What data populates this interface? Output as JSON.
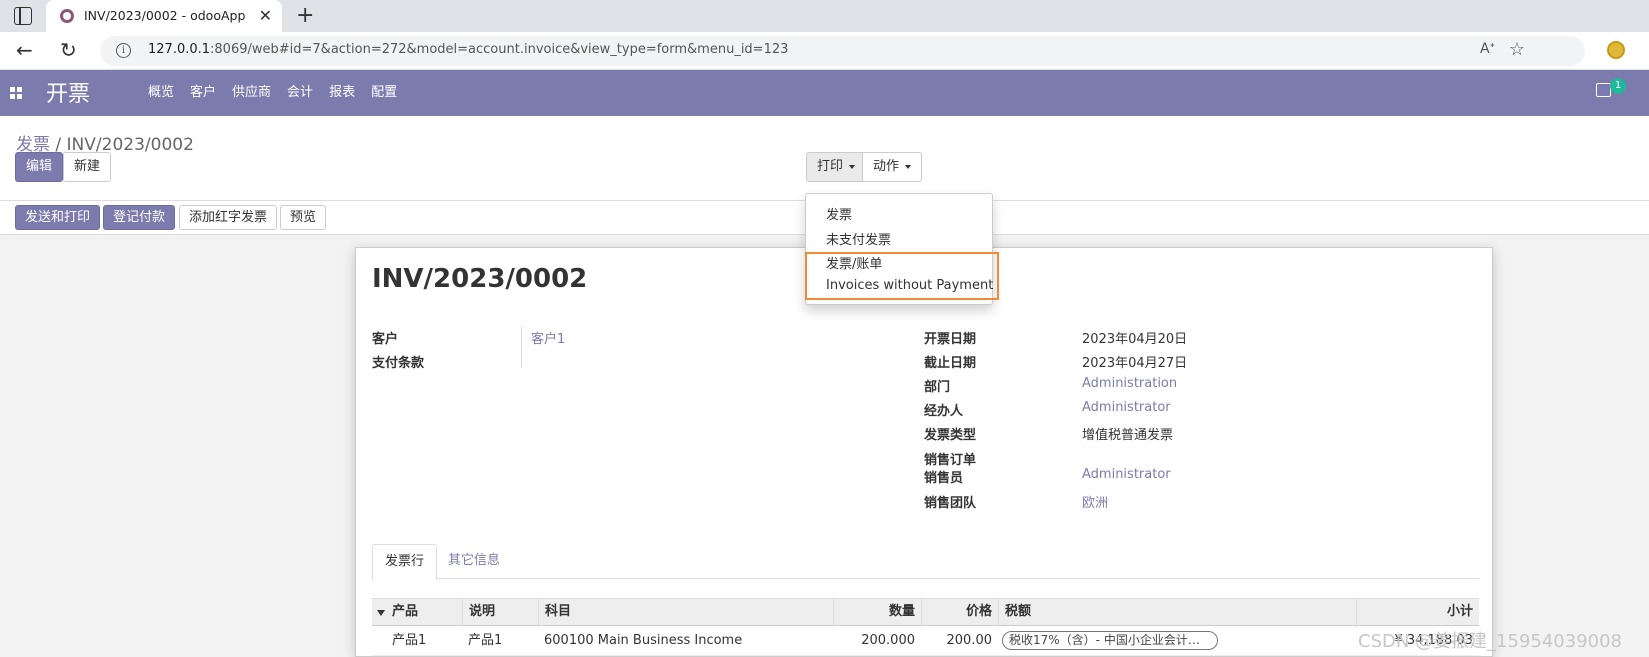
{
  "browser": {
    "tab_title": "INV/2023/0002 - odooApp",
    "url_host": "127.0.0.1",
    "url_rest": ":8069/web#id=7&action=272&model=account.invoice&view_type=form&menu_id=123",
    "icons": [
      "sidebar-icon",
      "odoo-favicon",
      "close-icon",
      "plus-icon",
      "back-icon",
      "reload-icon",
      "info-icon",
      "read-aloud-icon",
      "favorite-icon",
      "extension-icon"
    ]
  },
  "navbar": {
    "brand": "开票",
    "menu": [
      "概览",
      "客户",
      "供应商",
      "会计",
      "报表",
      "配置"
    ],
    "badge_count": "1",
    "colors": {
      "navbar_bg": "#7c7bad",
      "badge_bg": "#21b799"
    }
  },
  "control": {
    "breadcrumb_parent": "发票",
    "breadcrumb_sep": "/",
    "breadcrumb_current": "INV/2023/0002",
    "edit_label": "编辑",
    "new_label": "新建",
    "print_label": "打印",
    "action_label": "动作"
  },
  "print_menu": {
    "items": [
      "发票",
      "未支付发票",
      "发票/账单",
      "Invoices without Payment"
    ],
    "highlight_color": "#f08a35"
  },
  "statusbar": {
    "buttons": [
      "发送和打印",
      "登记付款",
      "添加红字发票",
      "预览"
    ]
  },
  "form": {
    "title": "INV/2023/0002",
    "left_fields": [
      {
        "label": "客户",
        "value": "客户1"
      },
      {
        "label": "支付条款",
        "value": ""
      }
    ],
    "right_fields": [
      {
        "label": "开票日期",
        "value": "2023年04月20日"
      },
      {
        "label": "截止日期",
        "value": "2023年04月27日"
      },
      {
        "label": "部门",
        "value": "Administration"
      },
      {
        "label": "经办人",
        "value": "Administrator"
      },
      {
        "label": "发票类型",
        "value": "增值税普通发票"
      },
      {
        "label": "销售订单",
        "value": ""
      },
      {
        "label": "销售员",
        "value": "Administrator"
      },
      {
        "label": "销售团队",
        "value": "欧洲"
      }
    ],
    "tabs": [
      "发票行",
      "其它信息"
    ]
  },
  "table": {
    "columns": [
      "产品",
      "说明",
      "科目",
      "数量",
      "价格",
      "税额",
      "小计"
    ],
    "rows": [
      {
        "product": "产品1",
        "description": "产品1",
        "account": "600100 Main Business Income",
        "qty": "200.000",
        "price": "200.00",
        "tax": "税收17%（含）- 中国小企业会计…",
        "subtotal": "¥ 34,188.03"
      }
    ]
  },
  "watermark": "CSDN @姜振建_15954039008"
}
